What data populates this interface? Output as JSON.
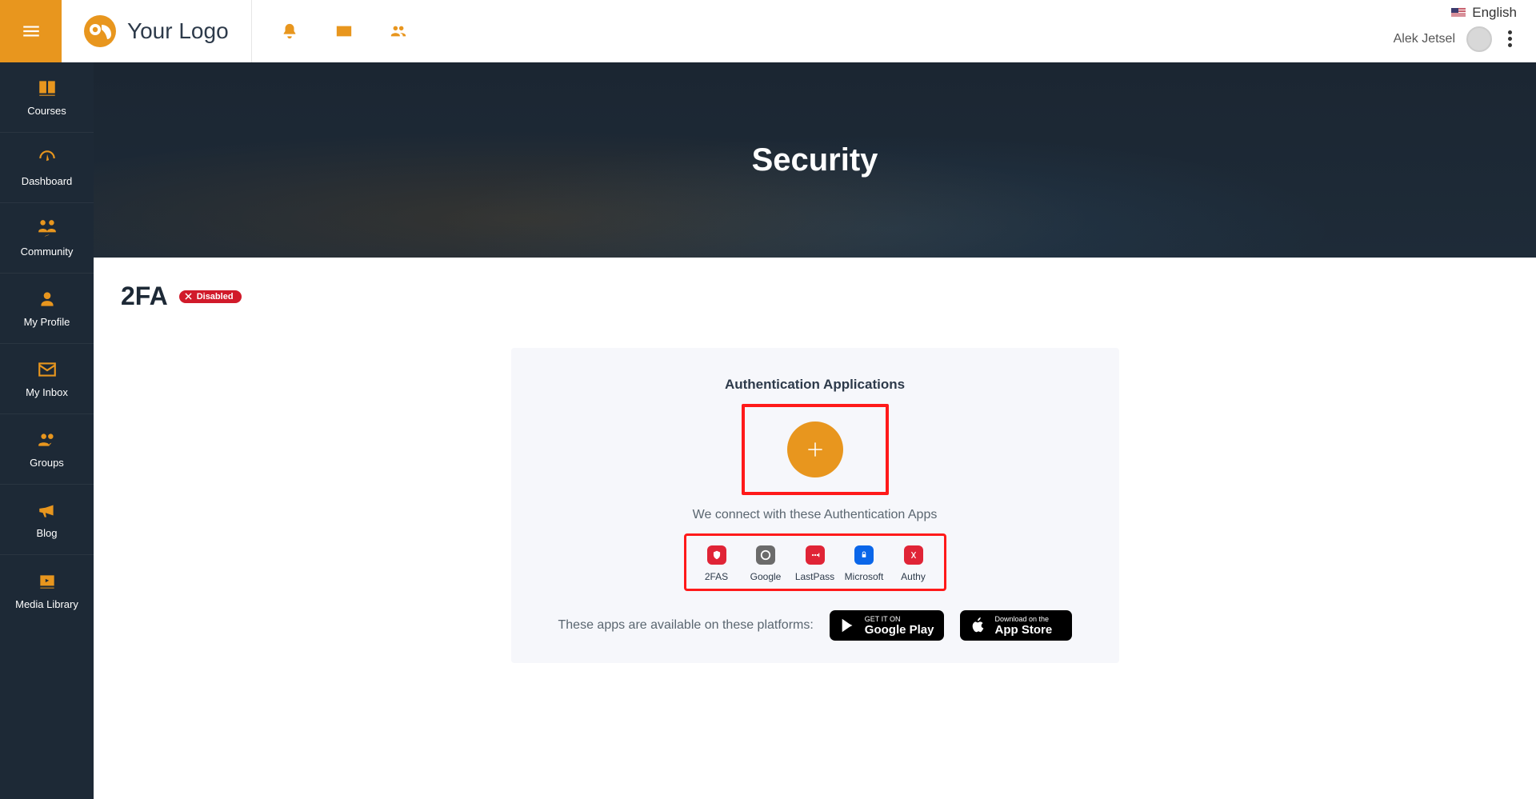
{
  "brand": {
    "name": "Your Logo"
  },
  "header": {
    "language": "English",
    "user_name": "Alek Jetsel"
  },
  "sidebar": {
    "items": [
      {
        "label": "Courses"
      },
      {
        "label": "Dashboard"
      },
      {
        "label": "Community"
      },
      {
        "label": "My Profile"
      },
      {
        "label": "My Inbox"
      },
      {
        "label": "Groups"
      },
      {
        "label": "Blog"
      },
      {
        "label": "Media Library"
      }
    ]
  },
  "hero": {
    "title": "Security"
  },
  "section": {
    "title": "2FA",
    "badge_label": "Disabled"
  },
  "panel": {
    "heading": "Authentication Applications",
    "connect_text": "We connect with these Authentication Apps",
    "apps": [
      {
        "label": "2FAS"
      },
      {
        "label": "Google"
      },
      {
        "label": "LastPass"
      },
      {
        "label": "Microsoft"
      },
      {
        "label": "Authy"
      }
    ],
    "platforms_text": "These apps are available on these platforms:",
    "google_play_small": "GET IT ON",
    "google_play_big": "Google Play",
    "app_store_small": "Download on the",
    "app_store_big": "App Store"
  }
}
